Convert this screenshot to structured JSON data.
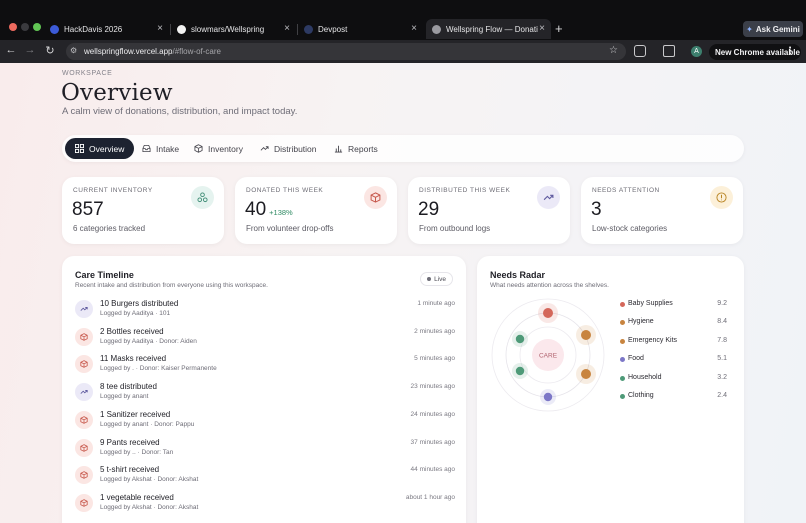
{
  "browser": {
    "tabs": [
      {
        "label": "HackDavis 2026",
        "favicon_color": "#3c5bd8"
      },
      {
        "label": "slowmars/Wellspring",
        "favicon_color": "#f2f2f2"
      },
      {
        "label": "Devpost",
        "favicon_color": "#2d3a63"
      },
      {
        "label": "Wellspring Flow — Donations",
        "favicon_color": "#9a9aa0"
      }
    ],
    "new_tab_symbol": "+",
    "ask_gemini": "Ask Gemini",
    "url_host": "wellspringflow.vercel.app",
    "url_path": "/#flow-of-care",
    "profile_initial": "A",
    "update_notice": "New Chrome available"
  },
  "header": {
    "eyebrow": "WORKSPACE",
    "title": "Overview",
    "subtitle": "A calm view of donations, distribution, and impact today."
  },
  "nav": {
    "tabs": [
      {
        "label": "Overview",
        "icon": "grid-icon"
      },
      {
        "label": "Intake",
        "icon": "inbox-icon"
      },
      {
        "label": "Inventory",
        "icon": "box-icon"
      },
      {
        "label": "Distribution",
        "icon": "handoff-icon"
      },
      {
        "label": "Reports",
        "icon": "bar-chart-icon"
      }
    ]
  },
  "stats": [
    {
      "label": "CURRENT INVENTORY",
      "value": "857",
      "delta": "",
      "sub": "6 categories tracked",
      "icon": "recycle-icon",
      "icon_bg": "#e5f3ef",
      "icon_color": "#3e8c75"
    },
    {
      "label": "DONATED THIS WEEK",
      "value": "40",
      "delta": "+138%",
      "sub": "From volunteer drop-offs",
      "icon": "box-icon",
      "icon_bg": "#fbe6e3",
      "icon_color": "#c7584c"
    },
    {
      "label": "DISTRIBUTED THIS WEEK",
      "value": "29",
      "delta": "",
      "sub": "From outbound logs",
      "icon": "handoff-icon",
      "icon_bg": "#ebe9f7",
      "icon_color": "#5f5a9f"
    },
    {
      "label": "NEEDS ATTENTION",
      "value": "3",
      "delta": "",
      "sub": "Low-stock categories",
      "icon": "alert-icon",
      "icon_bg": "#fcf0d9",
      "icon_color": "#b88422"
    }
  ],
  "timeline": {
    "title": "Care Timeline",
    "subtitle": "Recent intake and distribution from everyone using this workspace.",
    "badge": "Live",
    "items": [
      {
        "title": "10 Burgers distributed",
        "meta": "Logged by Aaditya · 101",
        "time": "1 minute ago",
        "kind": "distributed"
      },
      {
        "title": "2 Bottles received",
        "meta": "Logged by Aaditya · Donor: Aiden",
        "time": "2 minutes ago",
        "kind": "received"
      },
      {
        "title": "11 Masks received",
        "meta": "Logged by . · Donor: Kaiser Permanente",
        "time": "5 minutes ago",
        "kind": "received"
      },
      {
        "title": "8 tee distributed",
        "meta": "Logged by anant",
        "time": "23 minutes ago",
        "kind": "distributed"
      },
      {
        "title": "1 Sanitizer received",
        "meta": "Logged by anant · Donor: Pappu",
        "time": "24 minutes ago",
        "kind": "received"
      },
      {
        "title": "9 Pants received",
        "meta": "Logged by .. · Donor: Tan",
        "time": "37 minutes ago",
        "kind": "received"
      },
      {
        "title": "5 t-shirt received",
        "meta": "Logged by Akshat · Donor: Akshat",
        "time": "44 minutes ago",
        "kind": "received"
      },
      {
        "title": "1 vegetable received",
        "meta": "Logged by Akshat · Donor: Akshat",
        "time": "about 1 hour ago",
        "kind": "received"
      }
    ]
  },
  "radar": {
    "title": "Needs Radar",
    "subtitle": "What needs attention across the shelves.",
    "center_label": "CARE",
    "items": [
      {
        "name": "Baby Supplies",
        "value": "9.2",
        "color": "#d4675a"
      },
      {
        "name": "Hygiene",
        "value": "8.4",
        "color": "#c8843f"
      },
      {
        "name": "Emergency Kits",
        "value": "7.8",
        "color": "#c8843f"
      },
      {
        "name": "Food",
        "value": "5.1",
        "color": "#7c77c7"
      },
      {
        "name": "Household",
        "value": "3.2",
        "color": "#4e9a78"
      },
      {
        "name": "Clothing",
        "value": "2.4",
        "color": "#4e9a78"
      }
    ]
  }
}
